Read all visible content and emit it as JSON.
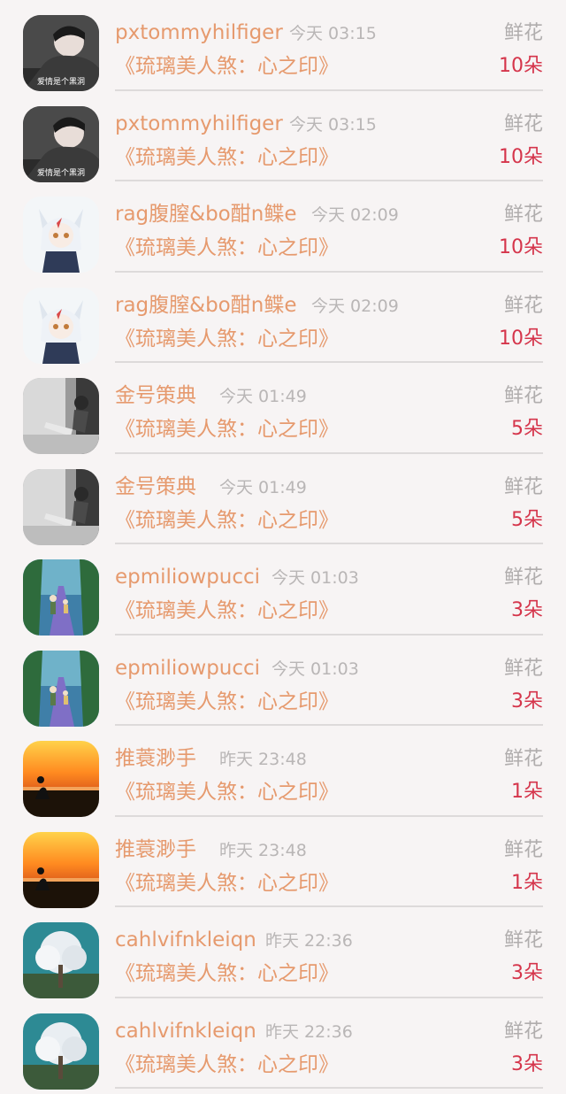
{
  "gift_rows": [
    {
      "user": "pxtommyhilfiger",
      "time": "今天 03:15",
      "gift": "鲜花",
      "book": "《琉璃美人煞：心之印》",
      "count": "10朵",
      "avatar_icon": "portrait-avatar-icon"
    },
    {
      "user": "pxtommyhilfiger",
      "time": "今天 03:15",
      "gift": "鲜花",
      "book": "《琉璃美人煞：心之印》",
      "count": "10朵",
      "avatar_icon": "portrait-avatar-icon"
    },
    {
      "user": "rag腹膣&bo酣n鲽e",
      "time": "今天 02:09",
      "gift": "鲜花",
      "book": "《琉璃美人煞：心之印》",
      "count": "10朵",
      "avatar_icon": "anime-avatar-icon"
    },
    {
      "user": "rag腹膣&bo酣n鲽e",
      "time": "今天 02:09",
      "gift": "鲜花",
      "book": "《琉璃美人煞：心之印》",
      "count": "10朵",
      "avatar_icon": "anime-avatar-icon"
    },
    {
      "user": "金号策典",
      "time": "今天 01:49",
      "gift": "鲜花",
      "book": "《琉璃美人煞：心之印》",
      "count": "5朵",
      "avatar_icon": "sitting-girl-avatar-icon"
    },
    {
      "user": "金号策典",
      "time": "今天 01:49",
      "gift": "鲜花",
      "book": "《琉璃美人煞：心之印》",
      "count": "5朵",
      "avatar_icon": "sitting-girl-avatar-icon"
    },
    {
      "user": "epmiliowpucci",
      "time": "今天 01:03",
      "gift": "鲜花",
      "book": "《琉璃美人煞：心之印》",
      "count": "3朵",
      "avatar_icon": "forest-path-avatar-icon"
    },
    {
      "user": "epmiliowpucci",
      "time": "今天 01:03",
      "gift": "鲜花",
      "book": "《琉璃美人煞：心之印》",
      "count": "3朵",
      "avatar_icon": "forest-path-avatar-icon"
    },
    {
      "user": "推蓑渺手",
      "time": "昨天 23:48",
      "gift": "鲜花",
      "book": "《琉璃美人煞：心之印》",
      "count": "1朵",
      "avatar_icon": "sunset-avatar-icon"
    },
    {
      "user": "推蓑渺手",
      "time": "昨天 23:48",
      "gift": "鲜花",
      "book": "《琉璃美人煞：心之印》",
      "count": "1朵",
      "avatar_icon": "sunset-avatar-icon"
    },
    {
      "user": "cahlvifnkleiqn",
      "time": "昨天 22:36",
      "gift": "鲜花",
      "book": "《琉璃美人煞：心之印》",
      "count": "3朵",
      "avatar_icon": "white-tree-avatar-icon"
    },
    {
      "user": "cahlvifnkleiqn",
      "time": "昨天 22:36",
      "gift": "鲜花",
      "book": "《琉璃美人煞：心之印》",
      "count": "3朵",
      "avatar_icon": "white-tree-avatar-icon"
    }
  ],
  "avatar_captions": {
    "portrait": "爱情是个黑洞"
  },
  "colors": {
    "background": "#f7f4f4",
    "username": "#e69a6e",
    "time": "#b9b6b6",
    "gift_label": "#b0adad",
    "count": "#d5354b",
    "divider": "#dddada"
  }
}
